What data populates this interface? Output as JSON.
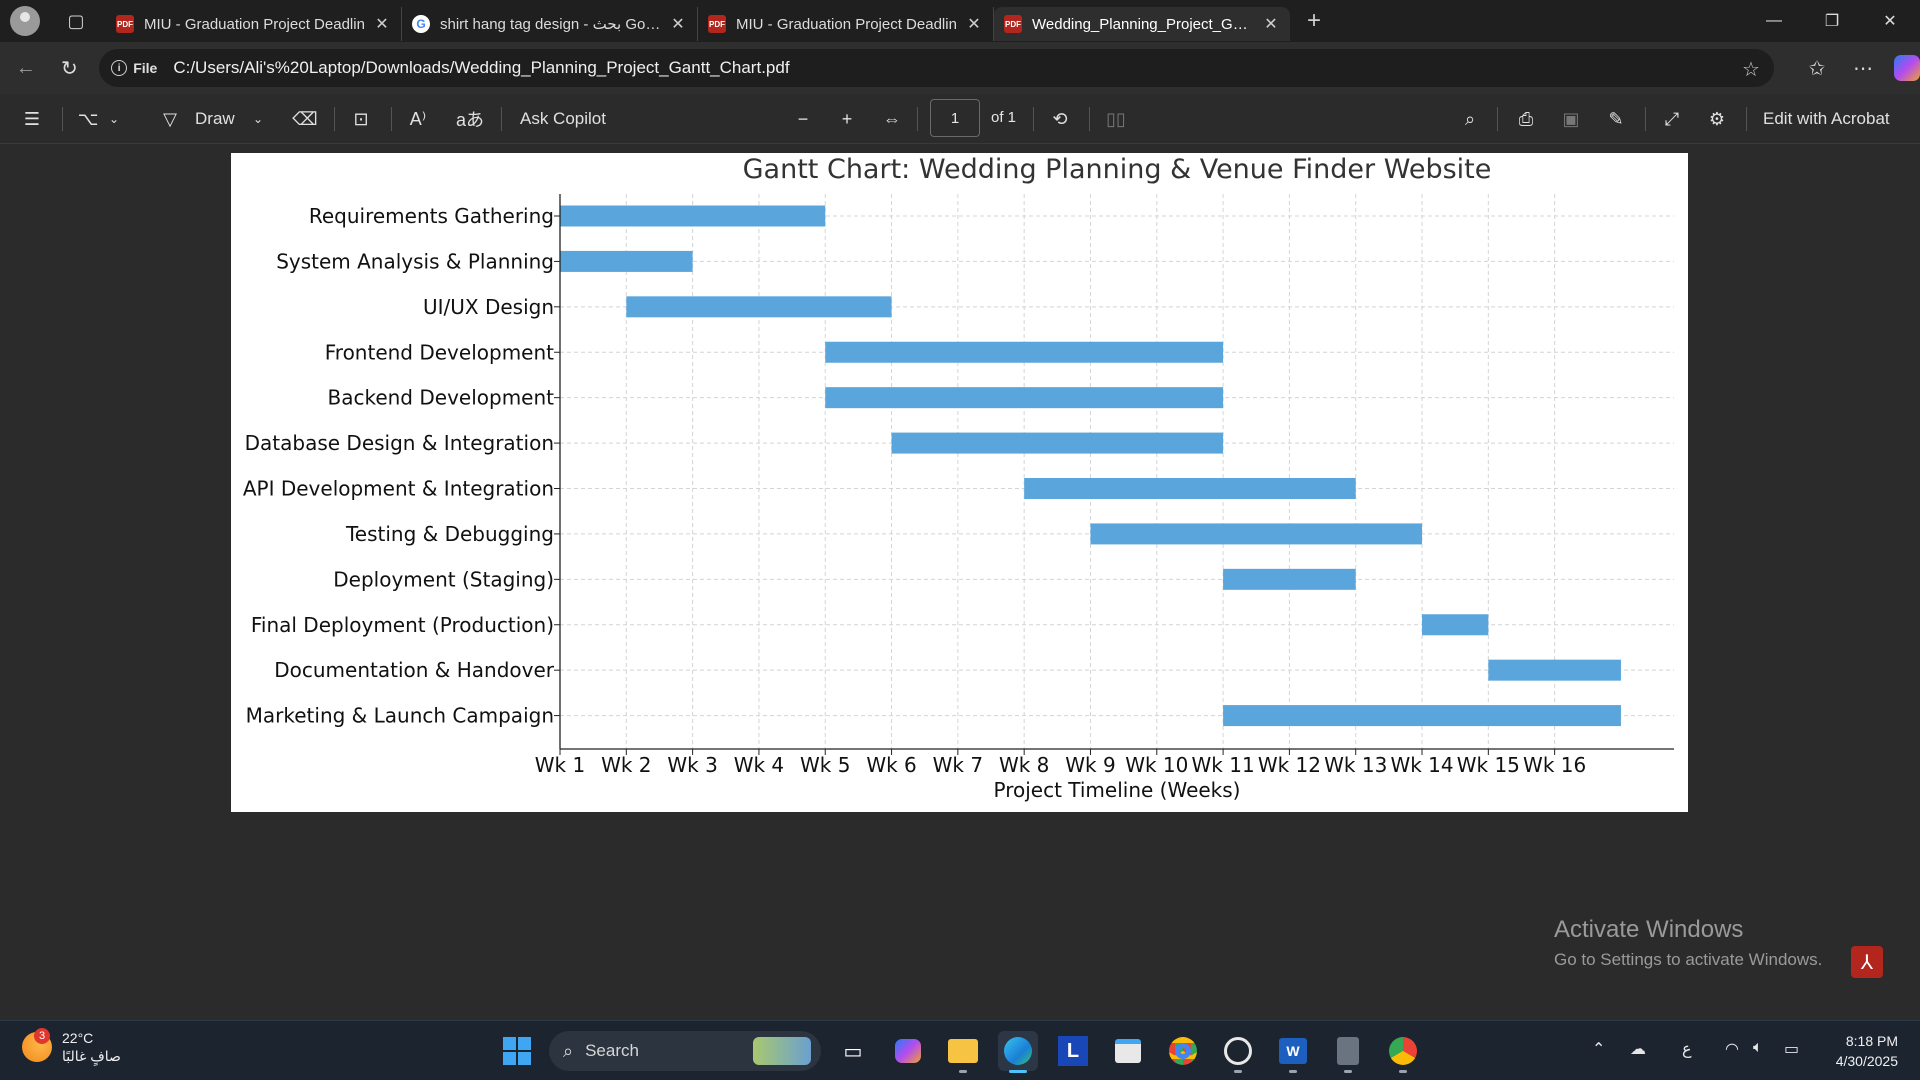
{
  "browser": {
    "tabs": [
      {
        "title": "MIU - Graduation Project Deadlin",
        "favicon": "pdf-icon"
      },
      {
        "title": "shirt hang tag design - بحث Goog",
        "favicon": "google-icon"
      },
      {
        "title": "MIU - Graduation Project Deadlin",
        "favicon": "pdf-icon"
      },
      {
        "title": "Wedding_Planning_Project_Gantt_",
        "favicon": "pdf-icon",
        "active": true
      }
    ],
    "new_tab_symbol": "+",
    "address": {
      "scheme_label": "File",
      "url": "C:/Users/Ali's%20Laptop/Downloads/Wedding_Planning_Project_Gantt_Chart.pdf"
    }
  },
  "pdf_toolbar": {
    "draw_label": "Draw",
    "ask_copilot_label": "Ask Copilot",
    "page_number": "1",
    "page_of": "of 1",
    "edit_with_acrobat_label": "Edit with Acrobat"
  },
  "chart_data": {
    "type": "bar",
    "orientation": "horizontal-gantt",
    "title": "Gantt Chart: Wedding Planning & Venue Finder Website",
    "xlabel": "Project Timeline (Weeks)",
    "ylabel": "",
    "x_ticks": [
      "Wk 1",
      "Wk 2",
      "Wk 3",
      "Wk 4",
      "Wk 5",
      "Wk 6",
      "Wk 7",
      "Wk 8",
      "Wk 9",
      "Wk 10",
      "Wk 11",
      "Wk 12",
      "Wk 13",
      "Wk 14",
      "Wk 15",
      "Wk 16"
    ],
    "xlim": [
      1,
      17.8
    ],
    "grid": true,
    "bar_color": "#5aa6dc",
    "tasks": [
      {
        "name": "Requirements Gathering",
        "start": 1,
        "end": 5
      },
      {
        "name": "System Analysis & Planning",
        "start": 1,
        "end": 3
      },
      {
        "name": "UI/UX Design",
        "start": 2,
        "end": 6
      },
      {
        "name": "Frontend Development",
        "start": 5,
        "end": 11
      },
      {
        "name": "Backend Development",
        "start": 5,
        "end": 11
      },
      {
        "name": "Database Design & Integration",
        "start": 6,
        "end": 11
      },
      {
        "name": "API Development & Integration",
        "start": 8,
        "end": 13
      },
      {
        "name": "Testing & Debugging",
        "start": 9,
        "end": 14
      },
      {
        "name": "Deployment (Staging)",
        "start": 11,
        "end": 13
      },
      {
        "name": "Final Deployment (Production)",
        "start": 14,
        "end": 15
      },
      {
        "name": "Documentation & Handover",
        "start": 15,
        "end": 17
      },
      {
        "name": "Marketing & Launch Campaign",
        "start": 11,
        "end": 17
      }
    ]
  },
  "watermark": {
    "line1": "Activate Windows",
    "line2": "Go to Settings to activate Windows."
  },
  "taskbar": {
    "weather_temp": "22°C",
    "weather_desc": "صافٍ غالبًا",
    "weather_badge": "3",
    "search_label": "Search",
    "input_lang": "ع",
    "time": "8:18 PM",
    "date": "4/30/2025"
  }
}
